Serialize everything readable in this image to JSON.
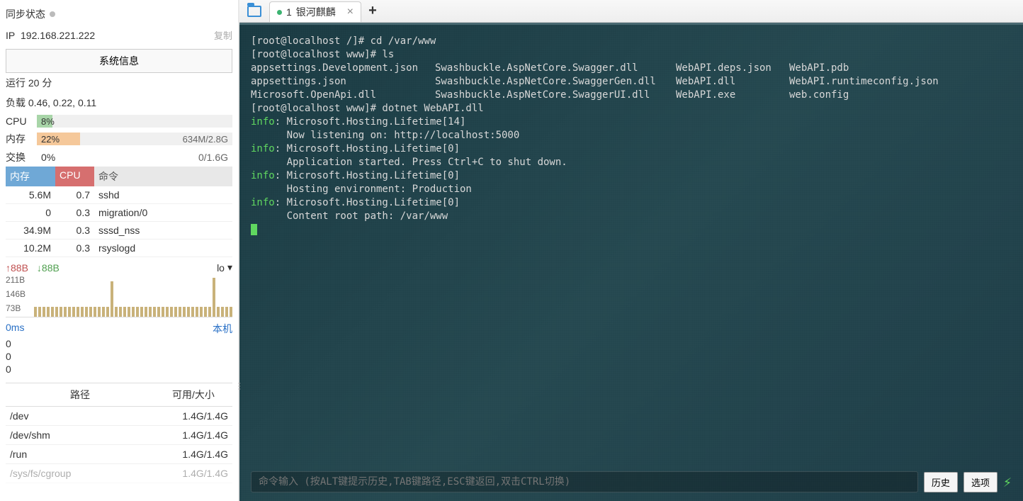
{
  "sync": {
    "label": "同步状态"
  },
  "ip": {
    "label": "IP",
    "value": "192.168.221.222",
    "copy": "复制"
  },
  "sysinfo_btn": "系统信息",
  "uptime": "运行 20 分",
  "load": "负载 0.46, 0.22, 0.11",
  "cpu": {
    "label": "CPU",
    "pct": "8%",
    "width": "8%"
  },
  "mem": {
    "label": "内存",
    "pct": "22%",
    "detail": "634M/2.8G",
    "width": "22%"
  },
  "swap": {
    "label": "交换",
    "pct": "0%",
    "detail": "0/1.6G"
  },
  "proc_head": {
    "mem": "内存",
    "cpu": "CPU",
    "cmd": "命令"
  },
  "procs": [
    {
      "mem": "5.6M",
      "cpu": "0.7",
      "cmd": "sshd"
    },
    {
      "mem": "0",
      "cpu": "0.3",
      "cmd": "migration/0"
    },
    {
      "mem": "34.9M",
      "cpu": "0.3",
      "cmd": "sssd_nss"
    },
    {
      "mem": "10.2M",
      "cpu": "0.3",
      "cmd": "rsyslogd"
    }
  ],
  "net": {
    "up": "88B",
    "down": "88B",
    "iface": "lo",
    "y": [
      "211B",
      "146B",
      "73B"
    ]
  },
  "latency": {
    "ms": "0ms",
    "host": "本机",
    "zeros": [
      "0",
      "0",
      "0"
    ]
  },
  "disk_head": {
    "path": "路径",
    "size": "可用/大小"
  },
  "disks": [
    {
      "path": "/dev",
      "size": "1.4G/1.4G"
    },
    {
      "path": "/dev/shm",
      "size": "1.4G/1.4G"
    },
    {
      "path": "/run",
      "size": "1.4G/1.4G"
    },
    {
      "path": "/sys/fs/cgroup",
      "size": "1.4G/1.4G"
    }
  ],
  "tab": {
    "num": "1",
    "title": "银河麒麟"
  },
  "term": {
    "l1": "[root@localhost /]# cd /var/www",
    "l2": "[root@localhost www]# ls",
    "ls_col1": "appsettings.Development.json\nappsettings.json\nMicrosoft.OpenApi.dll",
    "ls_col2": "Swashbuckle.AspNetCore.Swagger.dll\nSwashbuckle.AspNetCore.SwaggerGen.dll\nSwashbuckle.AspNetCore.SwaggerUI.dll",
    "ls_col3": "WebAPI.deps.json\nWebAPI.dll\nWebAPI.exe",
    "ls_col4": "WebAPI.pdb\nWebAPI.runtimeconfig.json\nweb.config",
    "l3": "[root@localhost www]# dotnet WebAPI.dll",
    "info": "info",
    "i1": ": Microsoft.Hosting.Lifetime[14]",
    "i1b": "      Now listening on: http://localhost:5000",
    "i2": ": Microsoft.Hosting.Lifetime[0]",
    "i2b": "      Application started. Press Ctrl+C to shut down.",
    "i3": ": Microsoft.Hosting.Lifetime[0]",
    "i3b": "      Hosting environment: Production",
    "i4": ": Microsoft.Hosting.Lifetime[0]",
    "i4b": "      Content root path: /var/www"
  },
  "footer": {
    "placeholder": "命令输入 (按ALT键提示历史,TAB键路径,ESC键返回,双击CTRL切换)",
    "history": "历史",
    "options": "选项"
  }
}
